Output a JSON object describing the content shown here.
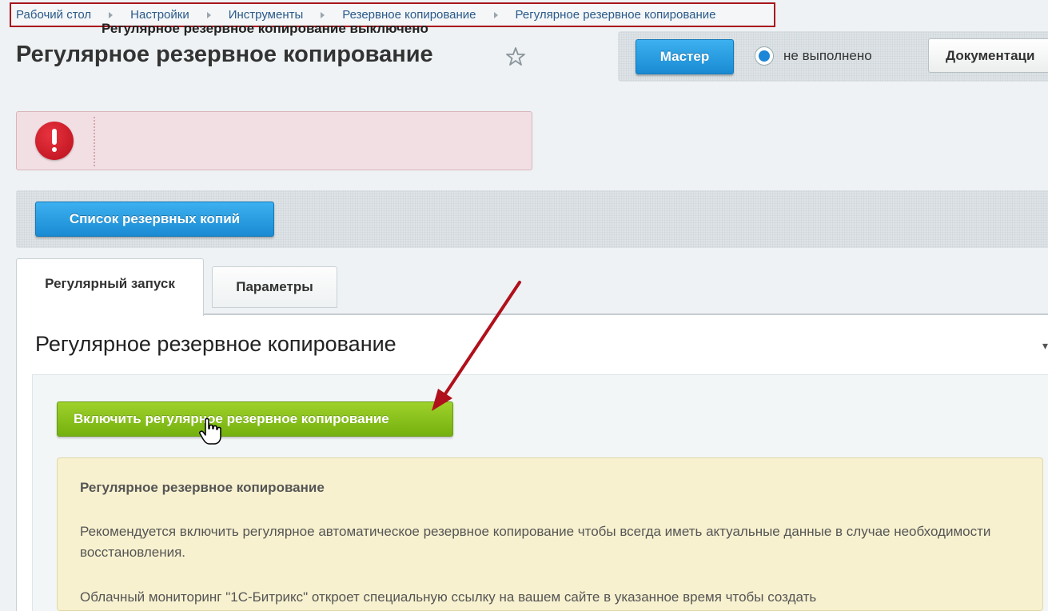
{
  "breadcrumb": {
    "items": [
      "Рабочий стол",
      "Настройки",
      "Инструменты",
      "Резервное копирование",
      "Регулярное резервное копирование"
    ]
  },
  "page": {
    "title": "Регулярное резервное копирование"
  },
  "topbar": {
    "master_label": "Мастер",
    "status_text": "не выполнено",
    "docs_label": "Документаци"
  },
  "alert": {
    "message": "Регулярное резервное копирование выключено"
  },
  "toolbar": {
    "backup_list_label": "Список резервных копий"
  },
  "tabs": [
    {
      "label": "Регулярный запуск",
      "active": true
    },
    {
      "label": "Параметры",
      "active": false
    }
  ],
  "panel": {
    "title": "Регулярное резервное копирование",
    "enable_button_label": "Включить регулярное резервное копирование"
  },
  "info": {
    "title": "Регулярное резервное копирование",
    "paragraph1": "Рекомендуется включить регулярное автоматическое резервное копирование чтобы всегда иметь актуальные данные в случае необходимости восстановления.",
    "paragraph2": "Облачный мониторинг \"1С-Битрикс\" откроет специальную ссылку на вашем сайте в указанное время чтобы создать"
  },
  "colors": {
    "breadcrumb_highlight": "#a8141c",
    "annotation_arrow": "#b0101c",
    "primary_blue": "#1a8bd3",
    "success_green": "#74b10f",
    "alert_bg": "#f2dfe3",
    "info_bg": "#f7f1cf"
  },
  "icons": [
    "star-icon",
    "radio-icon",
    "error-icon",
    "annotation-arrow",
    "hand-cursor-icon"
  ]
}
